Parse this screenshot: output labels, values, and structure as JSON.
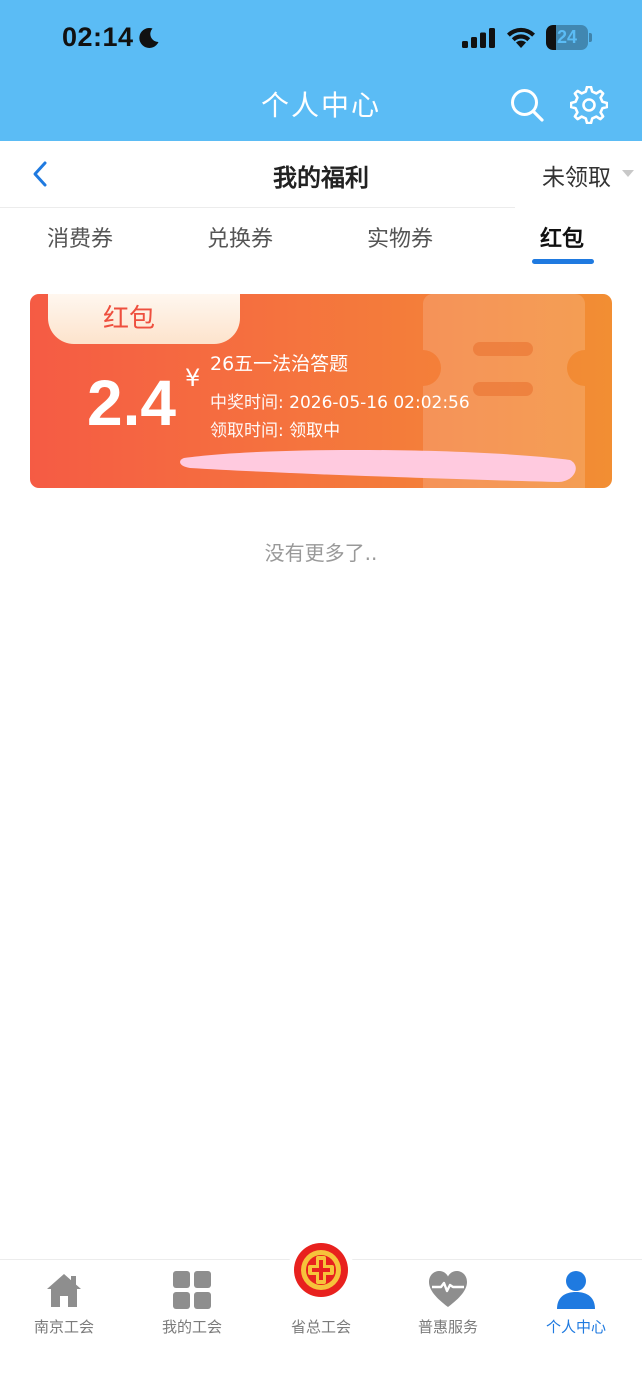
{
  "status_bar": {
    "time": "02:14",
    "battery_level": "24",
    "battery_fraction": 0.24
  },
  "header": {
    "title": "个人中心"
  },
  "subheader": {
    "title": "我的福利",
    "filter_value": "未领取"
  },
  "tabs": [
    {
      "label": "消费券",
      "active": false
    },
    {
      "label": "兑换券",
      "active": false
    },
    {
      "label": "实物券",
      "active": false
    },
    {
      "label": "红包",
      "active": true
    }
  ],
  "coupon": {
    "tag": "红包",
    "amount": "2.4",
    "currency": "¥",
    "name": "26五一法治答题",
    "win_time_label": "中奖时间:",
    "win_time": "2026-05-16 02:02:56",
    "claim_time_label": "领取时间:",
    "claim_time": "领取中"
  },
  "list_end_text": "没有更多了..",
  "bottom_nav": [
    {
      "label": "南京工会",
      "icon": "home-icon",
      "active": false
    },
    {
      "label": "我的工会",
      "icon": "grid-icon",
      "active": false
    },
    {
      "label": "省总工会",
      "icon": "union-emblem-icon",
      "active": false
    },
    {
      "label": "普惠服务",
      "icon": "heart-icon",
      "active": false
    },
    {
      "label": "个人中心",
      "icon": "person-icon",
      "active": true
    }
  ],
  "colors": {
    "header_blue": "#5bbcf5",
    "accent_blue": "#1f7ae0",
    "card_red": "#f55b44",
    "card_orange": "#f28e33"
  }
}
